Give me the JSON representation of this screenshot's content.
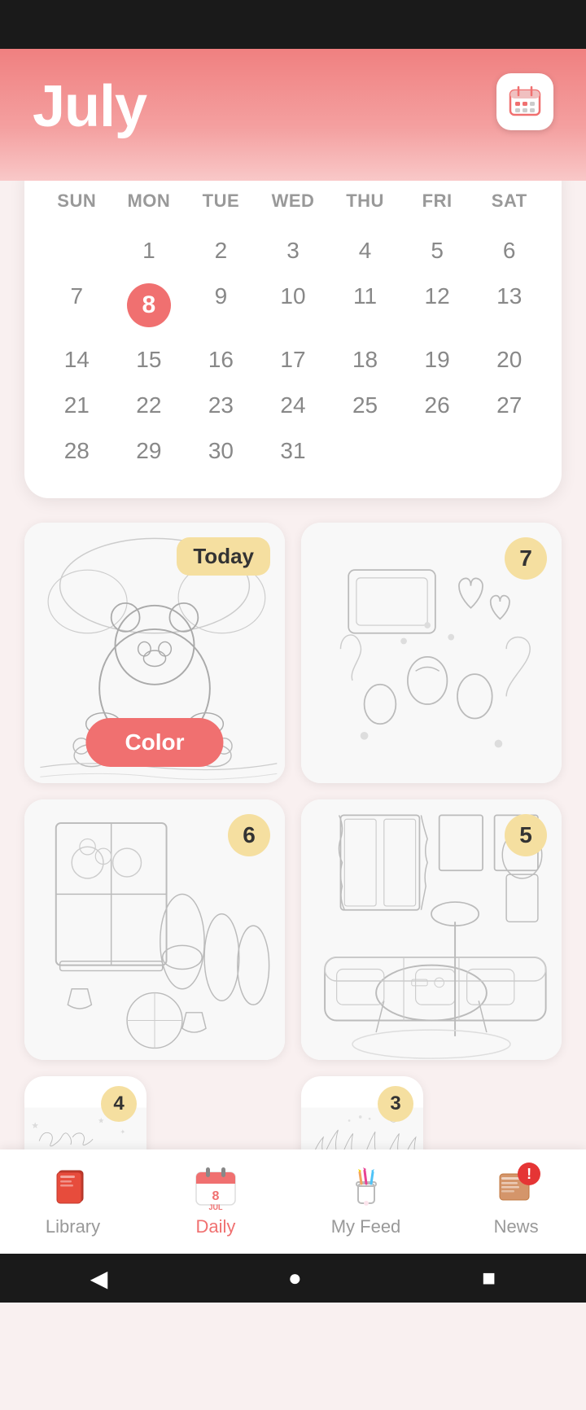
{
  "header": {
    "month": "July",
    "calendar_icon_label": "calendar"
  },
  "calendar": {
    "days_header": [
      "SUN",
      "MON",
      "TUE",
      "WED",
      "THU",
      "FRI",
      "SAT"
    ],
    "weeks": [
      [
        null,
        1,
        2,
        3,
        4,
        5,
        6
      ],
      [
        7,
        8,
        9,
        10,
        11,
        12,
        13
      ],
      [
        14,
        15,
        16,
        17,
        18,
        19,
        20
      ],
      [
        21,
        22,
        23,
        24,
        25,
        26,
        27
      ],
      [
        28,
        29,
        30,
        31,
        null,
        null,
        null
      ]
    ],
    "today": 8,
    "today_col": 1
  },
  "cards": [
    {
      "badge": "Today",
      "badge_type": "text",
      "has_color_btn": true,
      "color_btn_label": "Color",
      "desc": "bear coloring"
    },
    {
      "badge": "7",
      "badge_type": "num",
      "has_color_btn": false,
      "desc": "food coloring"
    },
    {
      "badge": "6",
      "badge_type": "num",
      "has_color_btn": false,
      "desc": "garden coloring"
    },
    {
      "badge": "5",
      "badge_type": "num",
      "has_color_btn": false,
      "desc": "living room coloring"
    },
    {
      "badge": "4",
      "badge_type": "num",
      "has_color_btn": false,
      "desc": "happy coloring"
    },
    {
      "badge": "3",
      "badge_type": "num",
      "has_color_btn": false,
      "desc": "plants coloring"
    }
  ],
  "bottom_nav": {
    "items": [
      {
        "id": "library",
        "label": "Library",
        "active": false,
        "icon": "book",
        "badge": null
      },
      {
        "id": "daily",
        "label": "Daily",
        "active": true,
        "icon": "calendar-daily",
        "badge": null
      },
      {
        "id": "myfeed",
        "label": "My Feed",
        "active": false,
        "icon": "pencils",
        "badge": null
      },
      {
        "id": "news",
        "label": "News",
        "active": false,
        "icon": "news",
        "badge": "!"
      }
    ]
  },
  "sys_nav": {
    "back": "◀",
    "home": "●",
    "recent": "■"
  }
}
